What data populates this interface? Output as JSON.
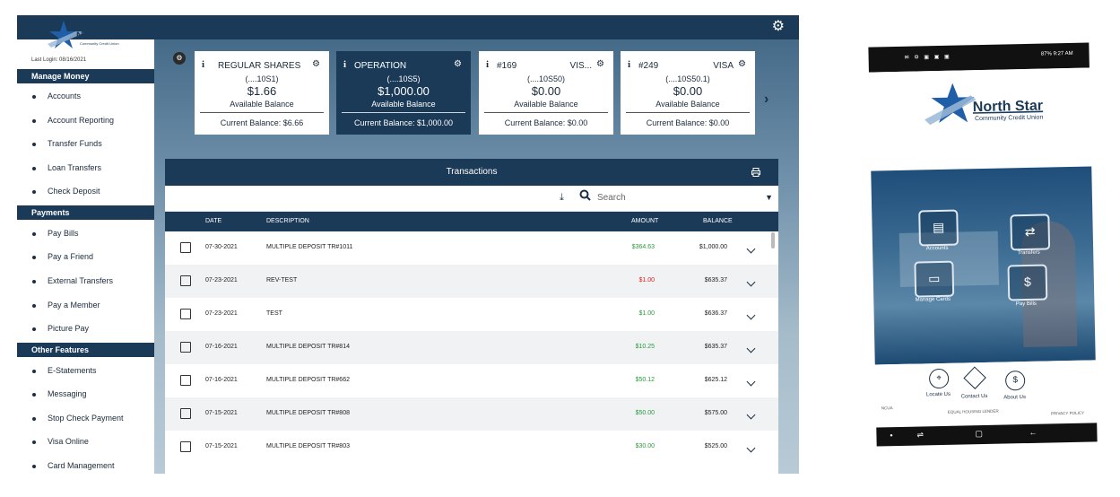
{
  "sidebar": {
    "last_login": "Last Login: 08/16/2021",
    "sections": [
      {
        "title": "Manage Money",
        "items": [
          "Accounts",
          "Account Reporting",
          "Transfer Funds",
          "Loan Transfers",
          "Check Deposit"
        ]
      },
      {
        "title": "Payments",
        "items": [
          "Pay Bills",
          "Pay a Friend",
          "External Transfers",
          "Pay a Member",
          "Picture Pay"
        ]
      },
      {
        "title": "Other Features",
        "items": [
          "E-Statements",
          "Messaging",
          "Stop Check Payment",
          "Visa Online",
          "Card Management"
        ]
      }
    ]
  },
  "logo": {
    "line1": "North Star",
    "line2": "Community Credit Union"
  },
  "accounts": [
    {
      "info": "i",
      "name": "REGULAR SHARES",
      "name2": "",
      "number": "(....10S1)",
      "balance": "$1.66",
      "avail_label": "Available Balance",
      "current": "Current Balance: $6.66",
      "active": false
    },
    {
      "info": "i",
      "name": "OPERATION",
      "name2": "",
      "number": "(....10S5)",
      "balance": "$1,000.00",
      "avail_label": "Available Balance",
      "current": "Current Balance: $1,000.00",
      "active": true
    },
    {
      "info": "i",
      "name": "#169",
      "name2": "VIS...",
      "number": "(....10S50)",
      "balance": "$0.00",
      "avail_label": "Available Balance",
      "current": "Current Balance: $0.00",
      "active": false
    },
    {
      "info": "i",
      "name": "#249",
      "name2": "VISA",
      "number": "(....10S50.1)",
      "balance": "$0.00",
      "avail_label": "Available Balance",
      "current": "Current Balance: $0.00",
      "active": false
    }
  ],
  "transactions": {
    "title": "Transactions",
    "search_placeholder": "Search",
    "columns": {
      "date": "DATE",
      "description": "DESCRIPTION",
      "amount": "AMOUNT",
      "balance": "BALANCE"
    },
    "rows": [
      {
        "date": "07-30-2021",
        "description": "MULTIPLE DEPOSIT TR#1011",
        "amount": "$364.63",
        "balance": "$1,000.00",
        "type": "credit"
      },
      {
        "date": "07-23-2021",
        "description": "REV-TEST",
        "amount": "$1.00",
        "balance": "$635.37",
        "type": "debit"
      },
      {
        "date": "07-23-2021",
        "description": "TEST",
        "amount": "$1.00",
        "balance": "$636.37",
        "type": "credit"
      },
      {
        "date": "07-16-2021",
        "description": "MULTIPLE DEPOSIT TR#814",
        "amount": "$10.25",
        "balance": "$635.37",
        "type": "credit"
      },
      {
        "date": "07-16-2021",
        "description": "MULTIPLE DEPOSIT TR#662",
        "amount": "$50.12",
        "balance": "$625.12",
        "type": "credit"
      },
      {
        "date": "07-15-2021",
        "description": "MULTIPLE DEPOSIT TR#808",
        "amount": "$50.00",
        "balance": "$575.00",
        "type": "credit"
      },
      {
        "date": "07-15-2021",
        "description": "MULTIPLE DEPOSIT TR#803",
        "amount": "$30.00",
        "balance": "$525.00",
        "type": "credit"
      }
    ]
  },
  "colors": {
    "navy": "#1b3a57",
    "credit": "#2a9a3a",
    "debit": "#dd2222"
  },
  "phone": {
    "status_right": "87% 9:27 AM",
    "tiles": [
      "Accounts",
      "Transfers",
      "Manage Cards",
      "Pay Bills"
    ],
    "bottom_links": [
      "Locate Us",
      "Contact Us",
      "About Us"
    ],
    "footer_left": "NCUA",
    "footer_center": "EQUAL HOUSING LENDER",
    "footer_right": "PRIVACY POLICY"
  }
}
